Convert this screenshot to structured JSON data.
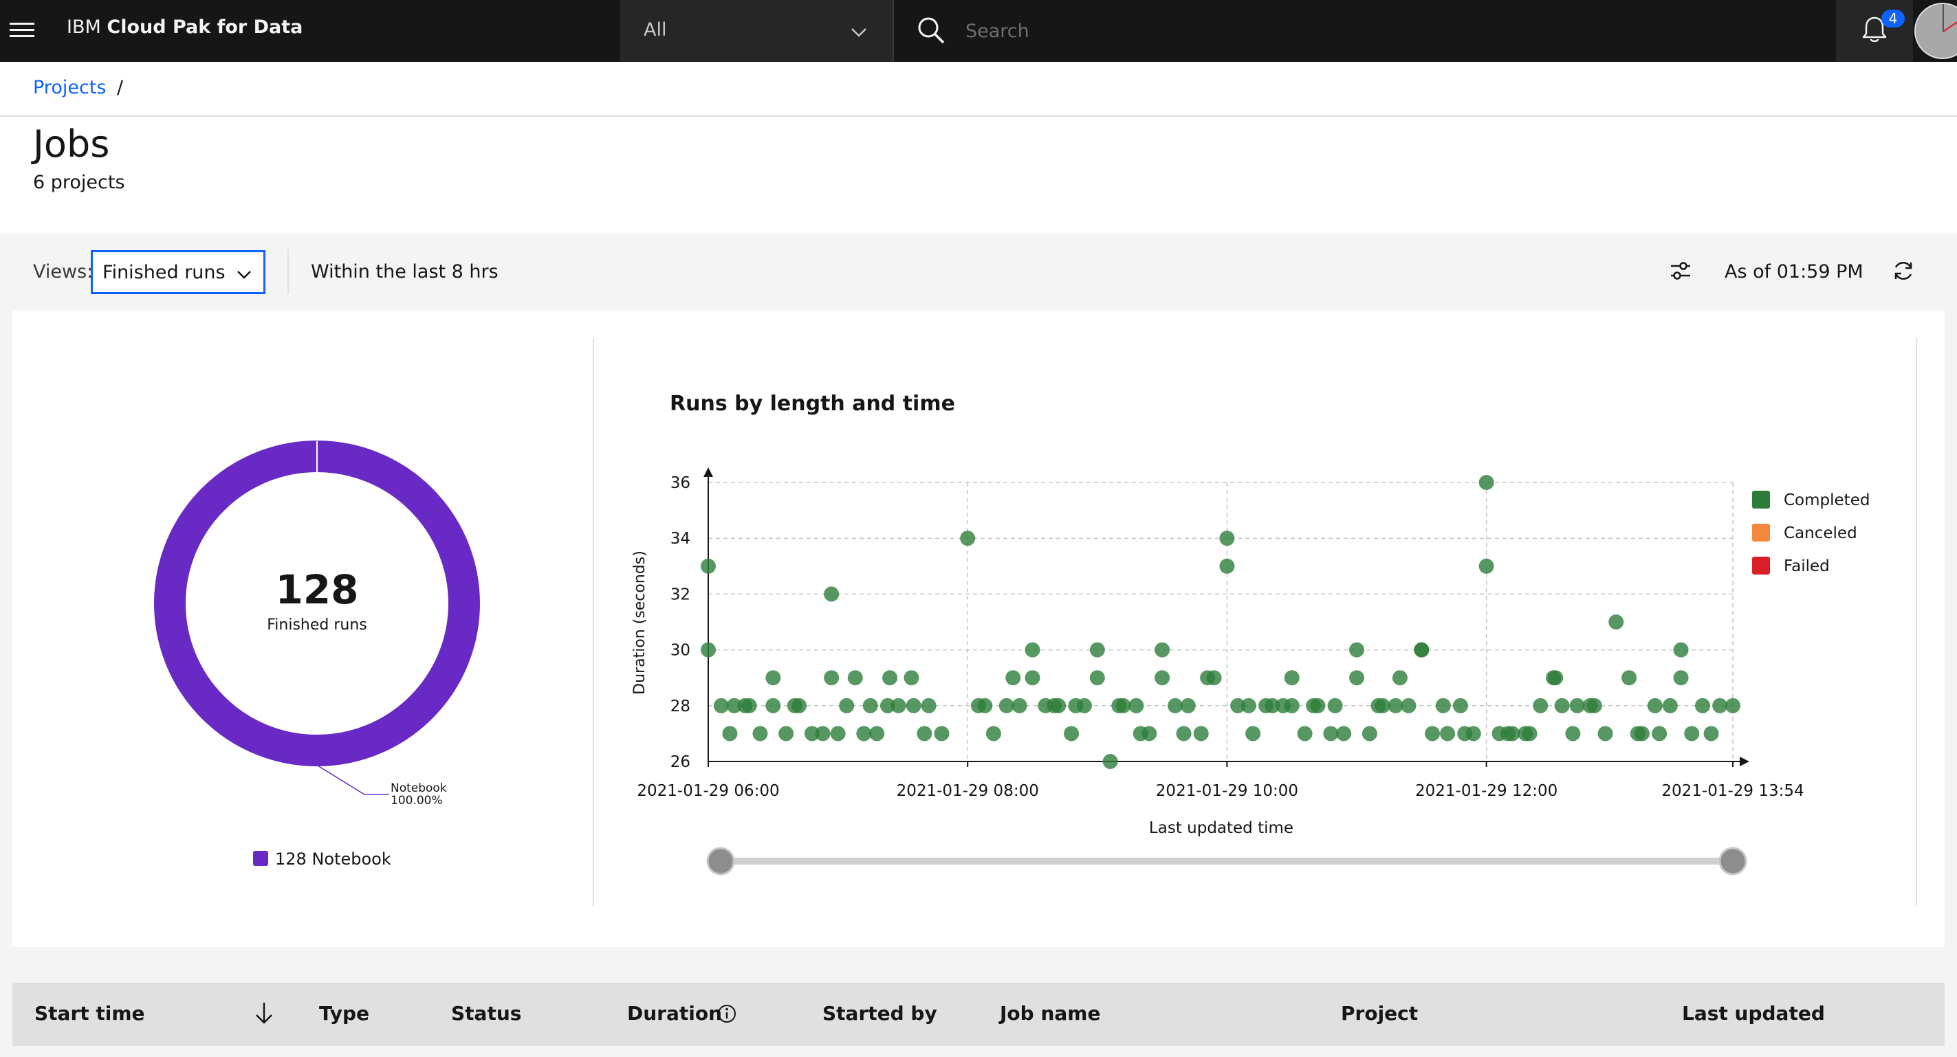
{
  "header": {
    "brand_prefix": "IBM",
    "brand_name": "Cloud Pak for Data",
    "scope_value": "All",
    "search_placeholder": "Search",
    "notification_count": "4"
  },
  "breadcrumb": {
    "projects_label": "Projects",
    "separator": "/"
  },
  "page": {
    "title": "Jobs",
    "subtitle": "6 projects"
  },
  "toolbar": {
    "views_label": "Views:",
    "views_value": "Finished runs",
    "range_text": "Within the last 8 hrs",
    "as_of_text": "As of 01:59 PM"
  },
  "donut": {
    "total": "128",
    "total_label": "Finished runs",
    "slice_label": "Notebook",
    "slice_percent": "100.00%",
    "slice_value": 100,
    "legend_text": "128 Notebook",
    "color": "#6929c4"
  },
  "chart_data": {
    "type": "scatter",
    "title": "Runs by length and time",
    "xlabel": "Last updated time",
    "ylabel": "Duration (seconds)",
    "ylim": [
      26,
      36
    ],
    "xlim": [
      "2021-01-29 06:00",
      "2021-01-29 13:54"
    ],
    "x_ticks": [
      "2021-01-29 06:00",
      "2021-01-29 08:00",
      "2021-01-29 10:00",
      "2021-01-29 12:00",
      "2021-01-29 13:54"
    ],
    "y_ticks": [
      "26",
      "28",
      "30",
      "32",
      "34",
      "36"
    ],
    "grid": true,
    "legend": [
      "Completed",
      "Canceled",
      "Failed"
    ],
    "legend_position": "right",
    "colors": {
      "Completed": "#2d7d3a",
      "Canceled": "#f1883c",
      "Failed": "#da1e28"
    },
    "series": [
      {
        "name": "Completed",
        "points": [
          [
            "2021-01-29 06:00",
            33
          ],
          [
            "2021-01-29 06:00",
            30
          ],
          [
            "2021-01-29 06:06",
            28
          ],
          [
            "2021-01-29 06:10",
            27
          ],
          [
            "2021-01-29 06:12",
            28
          ],
          [
            "2021-01-29 06:17",
            28
          ],
          [
            "2021-01-29 06:19",
            28
          ],
          [
            "2021-01-29 06:24",
            27
          ],
          [
            "2021-01-29 06:30",
            29
          ],
          [
            "2021-01-29 06:30",
            28
          ],
          [
            "2021-01-29 06:36",
            27
          ],
          [
            "2021-01-29 06:40",
            28
          ],
          [
            "2021-01-29 06:42",
            28
          ],
          [
            "2021-01-29 06:48",
            27
          ],
          [
            "2021-01-29 06:53",
            27
          ],
          [
            "2021-01-29 06:57",
            32
          ],
          [
            "2021-01-29 06:57",
            29
          ],
          [
            "2021-01-29 07:00",
            27
          ],
          [
            "2021-01-29 07:04",
            28
          ],
          [
            "2021-01-29 07:08",
            29
          ],
          [
            "2021-01-29 07:12",
            27
          ],
          [
            "2021-01-29 07:15",
            28
          ],
          [
            "2021-01-29 07:18",
            27
          ],
          [
            "2021-01-29 07:23",
            28
          ],
          [
            "2021-01-29 07:24",
            29
          ],
          [
            "2021-01-29 07:28",
            28
          ],
          [
            "2021-01-29 07:34",
            29
          ],
          [
            "2021-01-29 07:35",
            28
          ],
          [
            "2021-01-29 07:40",
            27
          ],
          [
            "2021-01-29 07:42",
            28
          ],
          [
            "2021-01-29 07:48",
            27
          ],
          [
            "2021-01-29 08:00",
            34
          ],
          [
            "2021-01-29 08:05",
            28
          ],
          [
            "2021-01-29 08:08",
            28
          ],
          [
            "2021-01-29 08:12",
            27
          ],
          [
            "2021-01-29 08:18",
            28
          ],
          [
            "2021-01-29 08:21",
            29
          ],
          [
            "2021-01-29 08:24",
            28
          ],
          [
            "2021-01-29 08:30",
            30
          ],
          [
            "2021-01-29 08:30",
            29
          ],
          [
            "2021-01-29 08:36",
            28
          ],
          [
            "2021-01-29 08:40",
            28
          ],
          [
            "2021-01-29 08:42",
            28
          ],
          [
            "2021-01-29 08:48",
            27
          ],
          [
            "2021-01-29 08:50",
            28
          ],
          [
            "2021-01-29 08:54",
            28
          ],
          [
            "2021-01-29 09:00",
            30
          ],
          [
            "2021-01-29 09:00",
            29
          ],
          [
            "2021-01-29 09:06",
            26
          ],
          [
            "2021-01-29 09:10",
            28
          ],
          [
            "2021-01-29 09:12",
            28
          ],
          [
            "2021-01-29 09:18",
            28
          ],
          [
            "2021-01-29 09:20",
            27
          ],
          [
            "2021-01-29 09:24",
            27
          ],
          [
            "2021-01-29 09:30",
            30
          ],
          [
            "2021-01-29 09:30",
            29
          ],
          [
            "2021-01-29 09:36",
            28
          ],
          [
            "2021-01-29 09:40",
            27
          ],
          [
            "2021-01-29 09:42",
            28
          ],
          [
            "2021-01-29 09:48",
            27
          ],
          [
            "2021-01-29 09:51",
            29
          ],
          [
            "2021-01-29 09:54",
            29
          ],
          [
            "2021-01-29 10:00",
            34
          ],
          [
            "2021-01-29 10:00",
            33
          ],
          [
            "2021-01-29 10:05",
            28
          ],
          [
            "2021-01-29 10:10",
            28
          ],
          [
            "2021-01-29 10:12",
            27
          ],
          [
            "2021-01-29 10:18",
            28
          ],
          [
            "2021-01-29 10:21",
            28
          ],
          [
            "2021-01-29 10:26",
            28
          ],
          [
            "2021-01-29 10:30",
            29
          ],
          [
            "2021-01-29 10:30",
            28
          ],
          [
            "2021-01-29 10:36",
            27
          ],
          [
            "2021-01-29 10:40",
            28
          ],
          [
            "2021-01-29 10:42",
            28
          ],
          [
            "2021-01-29 10:48",
            27
          ],
          [
            "2021-01-29 10:50",
            28
          ],
          [
            "2021-01-29 10:54",
            27
          ],
          [
            "2021-01-29 11:00",
            30
          ],
          [
            "2021-01-29 11:00",
            29
          ],
          [
            "2021-01-29 11:06",
            27
          ],
          [
            "2021-01-29 11:10",
            28
          ],
          [
            "2021-01-29 11:12",
            28
          ],
          [
            "2021-01-29 11:18",
            28
          ],
          [
            "2021-01-29 11:20",
            29
          ],
          [
            "2021-01-29 11:24",
            28
          ],
          [
            "2021-01-29 11:30",
            30
          ],
          [
            "2021-01-29 11:35",
            27
          ],
          [
            "2021-01-29 11:40",
            28
          ],
          [
            "2021-01-29 11:42",
            27
          ],
          [
            "2021-01-29 11:48",
            28
          ],
          [
            "2021-01-29 11:50",
            27
          ],
          [
            "2021-01-29 11:54",
            27
          ],
          [
            "2021-01-29 12:00",
            36
          ],
          [
            "2021-01-29 12:00",
            33
          ],
          [
            "2021-01-29 12:06",
            27
          ],
          [
            "2021-01-29 12:10",
            27
          ],
          [
            "2021-01-29 12:12",
            27
          ],
          [
            "2021-01-29 12:18",
            27
          ],
          [
            "2021-01-29 12:20",
            27
          ],
          [
            "2021-01-29 12:25",
            28
          ],
          [
            "2021-01-29 12:31",
            29
          ],
          [
            "2021-01-29 12:35",
            28
          ],
          [
            "2021-01-29 12:40",
            27
          ],
          [
            "2021-01-29 12:42",
            28
          ],
          [
            "2021-01-29 12:48",
            28
          ],
          [
            "2021-01-29 12:50",
            28
          ],
          [
            "2021-01-29 12:55",
            27
          ],
          [
            "2021-01-29 13:00",
            31
          ],
          [
            "2021-01-29 13:06",
            29
          ],
          [
            "2021-01-29 13:10",
            27
          ],
          [
            "2021-01-29 13:12",
            27
          ],
          [
            "2021-01-29 13:18",
            28
          ],
          [
            "2021-01-29 13:20",
            27
          ],
          [
            "2021-01-29 13:25",
            28
          ],
          [
            "2021-01-29 13:30",
            30
          ],
          [
            "2021-01-29 13:30",
            29
          ],
          [
            "2021-01-29 13:35",
            27
          ],
          [
            "2021-01-29 13:40",
            28
          ],
          [
            "2021-01-29 13:44",
            27
          ],
          [
            "2021-01-29 13:48",
            28
          ],
          [
            "2021-01-29 13:54",
            28
          ],
          [
            "2021-01-29 11:30",
            30
          ],
          [
            "2021-01-29 12:32",
            29
          ]
        ]
      },
      {
        "name": "Canceled",
        "points": []
      },
      {
        "name": "Failed",
        "points": []
      }
    ]
  },
  "table": {
    "columns": [
      "Start time",
      "Type",
      "Status",
      "Duration",
      "Started by",
      "Job name",
      "Project",
      "Last updated"
    ]
  }
}
